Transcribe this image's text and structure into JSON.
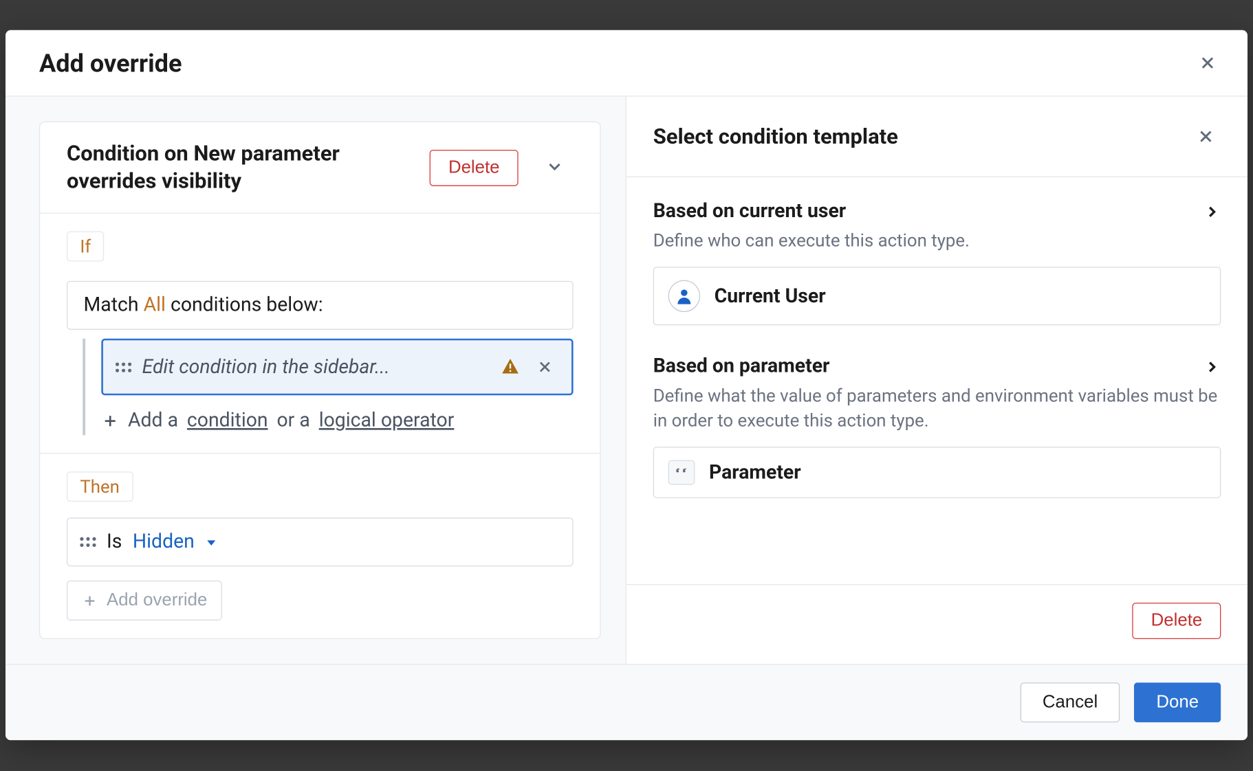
{
  "modal": {
    "title": "Add override"
  },
  "condition_card": {
    "title": "Condition on New parameter overrides visibility",
    "delete_label": "Delete",
    "if_tag": "If",
    "match_prefix": "Match",
    "match_all": "All",
    "match_suffix": "conditions below:",
    "edit_placeholder": "Edit condition in the sidebar...",
    "add_row_prefix": "Add a",
    "add_row_condition": "condition",
    "add_row_or": "or a",
    "add_row_operator": "logical operator",
    "then_tag": "Then",
    "then_is": "Is",
    "then_value": "Hidden",
    "add_override_label": "Add override"
  },
  "right": {
    "title": "Select condition template",
    "templates": [
      {
        "title": "Based on current user",
        "desc": "Define who can execute this action type.",
        "option_label": "Current User",
        "icon": "user"
      },
      {
        "title": "Based on parameter",
        "desc": "Define what the value of parameters and environment variables must be in order to execute this action type.",
        "option_label": "Parameter",
        "icon": "quote"
      }
    ],
    "delete_label": "Delete"
  },
  "footer": {
    "cancel": "Cancel",
    "done": "Done"
  }
}
